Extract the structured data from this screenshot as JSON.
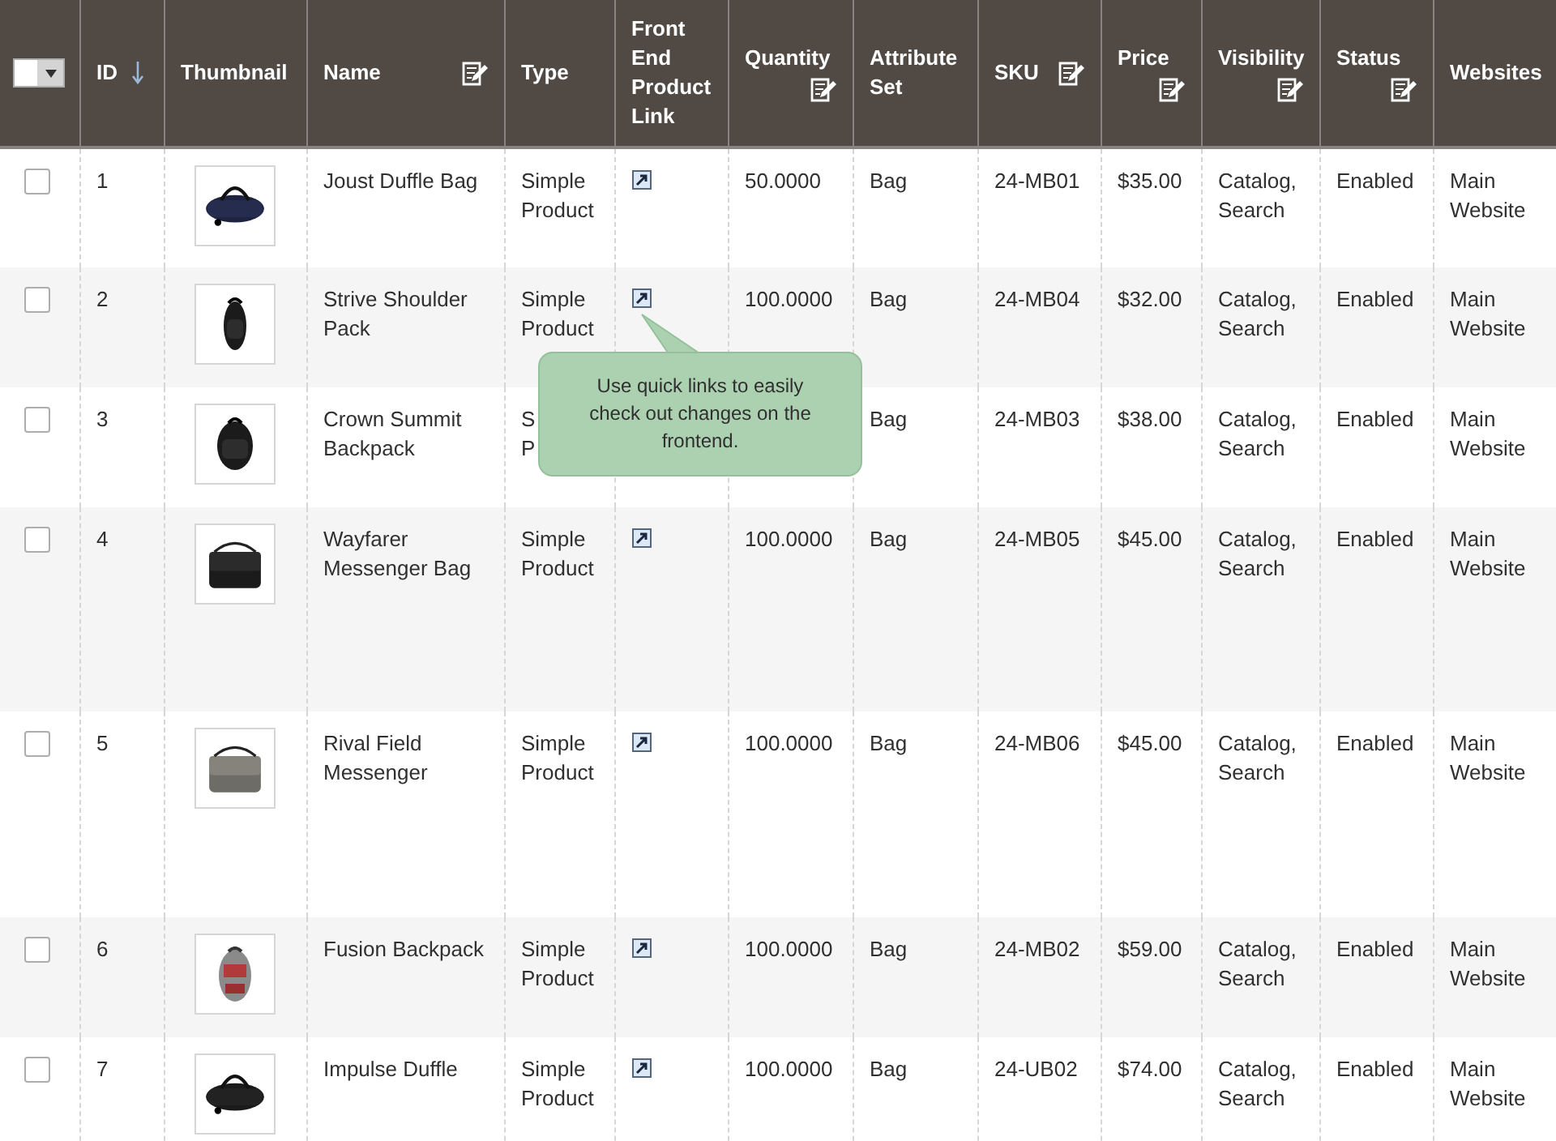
{
  "columns": [
    {
      "kind": "select",
      "checked": false
    },
    {
      "label": "ID",
      "kind": "sort",
      "sorted": true
    },
    {
      "label": "Thumbnail",
      "kind": "plain"
    },
    {
      "label": "Name",
      "kind": "edit"
    },
    {
      "label": "Type",
      "kind": "plain"
    },
    {
      "label": "Front End Product Link",
      "kind": "plain"
    },
    {
      "label": "Quantity",
      "kind": "edit"
    },
    {
      "label": "Attribute Set",
      "kind": "plain"
    },
    {
      "label": "SKU",
      "kind": "edit"
    },
    {
      "label": "Price",
      "kind": "edit"
    },
    {
      "label": "Visibility",
      "kind": "edit"
    },
    {
      "label": "Status",
      "kind": "edit"
    },
    {
      "label": "Websites",
      "kind": "plain"
    }
  ],
  "rows": [
    {
      "checked": false,
      "id": "1",
      "name": "Joust Duffle Bag",
      "type": "Simple Product",
      "quick_link": true,
      "quantity": "50.0000",
      "attribute_set": "Bag",
      "sku": "24-MB01",
      "price": "$35.00",
      "visibility": "Catalog, Search",
      "status": "Enabled",
      "websites": "Main Website"
    },
    {
      "checked": false,
      "id": "2",
      "name": "Strive Shoulder Pack",
      "type": "Simple Product",
      "quick_link": true,
      "quantity": "100.0000",
      "attribute_set": "Bag",
      "sku": "24-MB04",
      "price": "$32.00",
      "visibility": "Catalog, Search",
      "status": "Enabled",
      "websites": "Main Website"
    },
    {
      "checked": false,
      "id": "3",
      "name": "Crown Summit Backpack",
      "type": "S\nP",
      "attribute_set": "Bag",
      "sku": "24-MB03",
      "price": "$38.00",
      "visibility": "Catalog, Search",
      "status": "Enabled",
      "websites": "Main Website"
    },
    {
      "checked": false,
      "id": "4",
      "name": "Wayfarer Messenger Bag",
      "type": "Simple Product",
      "quick_link": true,
      "quantity": "100.0000",
      "attribute_set": "Bag",
      "sku": "24-MB05",
      "price": "$45.00",
      "visibility": "Catalog, Search",
      "status": "Enabled",
      "websites": "Main Website"
    },
    {
      "checked": false,
      "id": "5",
      "name": "Rival Field Messenger",
      "type": "Simple Product",
      "quick_link": true,
      "quantity": "100.0000",
      "attribute_set": "Bag",
      "sku": "24-MB06",
      "price": "$45.00",
      "visibility": "Catalog, Search",
      "status": "Enabled",
      "websites": "Main Website"
    },
    {
      "checked": false,
      "id": "6",
      "name": "Fusion Backpack",
      "type": "Simple Product",
      "quick_link": true,
      "quantity": "100.0000",
      "attribute_set": "Bag",
      "sku": "24-MB02",
      "price": "$59.00",
      "visibility": "Catalog, Search",
      "status": "Enabled",
      "websites": "Main Website"
    },
    {
      "checked": false,
      "id": "7",
      "name": "Impulse Duffle",
      "type": "Simple Product",
      "quick_link": true,
      "quantity": "100.0000",
      "attribute_set": "Bag",
      "sku": "24-UB02",
      "price": "$74.00",
      "visibility": "Catalog, Search",
      "status": "Enabled",
      "websites": "Main Website"
    }
  ],
  "tooltip": {
    "text": "Use quick links to easily check out changes on the frontend."
  }
}
